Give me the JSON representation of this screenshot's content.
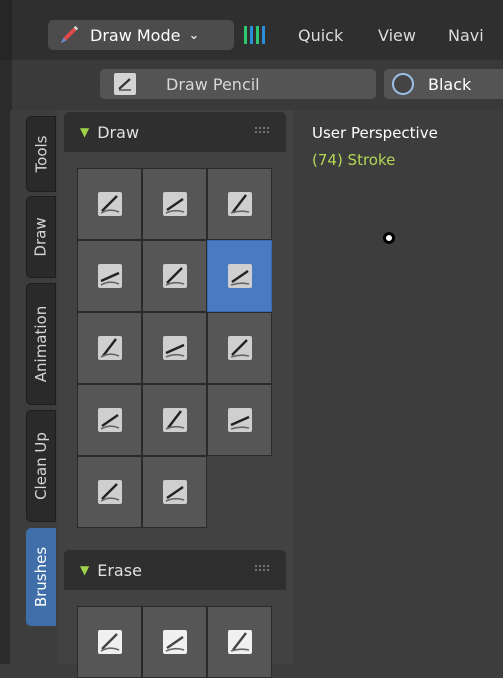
{
  "header": {
    "mode_label": "Draw Mode",
    "menu": [
      "Quick",
      "View",
      "Navi"
    ]
  },
  "toolbar": {
    "brush_name": "Draw Pencil",
    "color_name": "Black"
  },
  "tabs": [
    "Tools",
    "Draw",
    "Animation",
    "Clean Up",
    "Brushes"
  ],
  "active_tab": "Brushes",
  "panels": {
    "draw": {
      "title": "Draw"
    },
    "erase": {
      "title": "Erase"
    }
  },
  "viewport": {
    "title": "User Perspective",
    "status": "(74) Stroke"
  },
  "colors": {
    "accent": "#4a7bc2",
    "status_green": "#b4d656",
    "panel_triangle": "#9fd34a"
  }
}
